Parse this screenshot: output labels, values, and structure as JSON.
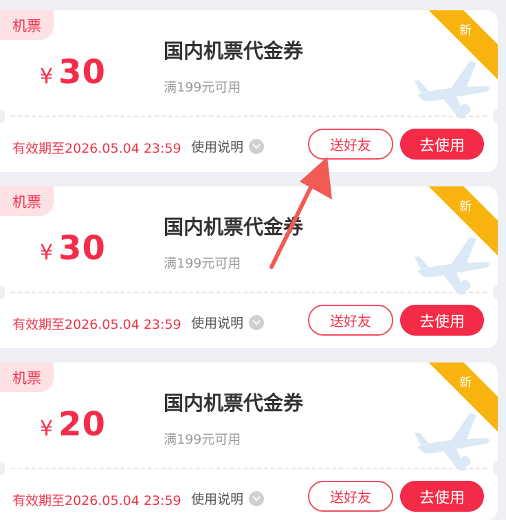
{
  "coupons": [
    {
      "tag": "机票",
      "currency": "¥",
      "amount": "30",
      "title": "国内机票代金券",
      "condition": "满199元可用",
      "validity": "有效期至2026.05.04 23:59",
      "help": "使用说明",
      "gift": "送好友",
      "use": "去使用",
      "badge": "新"
    },
    {
      "tag": "机票",
      "currency": "¥",
      "amount": "30",
      "title": "国内机票代金券",
      "condition": "满199元可用",
      "validity": "有效期至2026.05.04 23:59",
      "help": "使用说明",
      "gift": "送好友",
      "use": "去使用",
      "badge": "新"
    },
    {
      "tag": "机票",
      "currency": "¥",
      "amount": "20",
      "title": "国内机票代金券",
      "condition": "满199元可用",
      "validity": "有效期至2026.05.04 23:59",
      "help": "使用说明",
      "gift": "送好友",
      "use": "去使用",
      "badge": "新"
    }
  ],
  "icons": {
    "help": "chevron-down-icon",
    "plane": "airplane-icon",
    "arrow": "annotation-arrow-icon"
  },
  "colors": {
    "accent": "#f42b47",
    "badge": "#f9b30f",
    "tagBg": "#fde1e4"
  }
}
